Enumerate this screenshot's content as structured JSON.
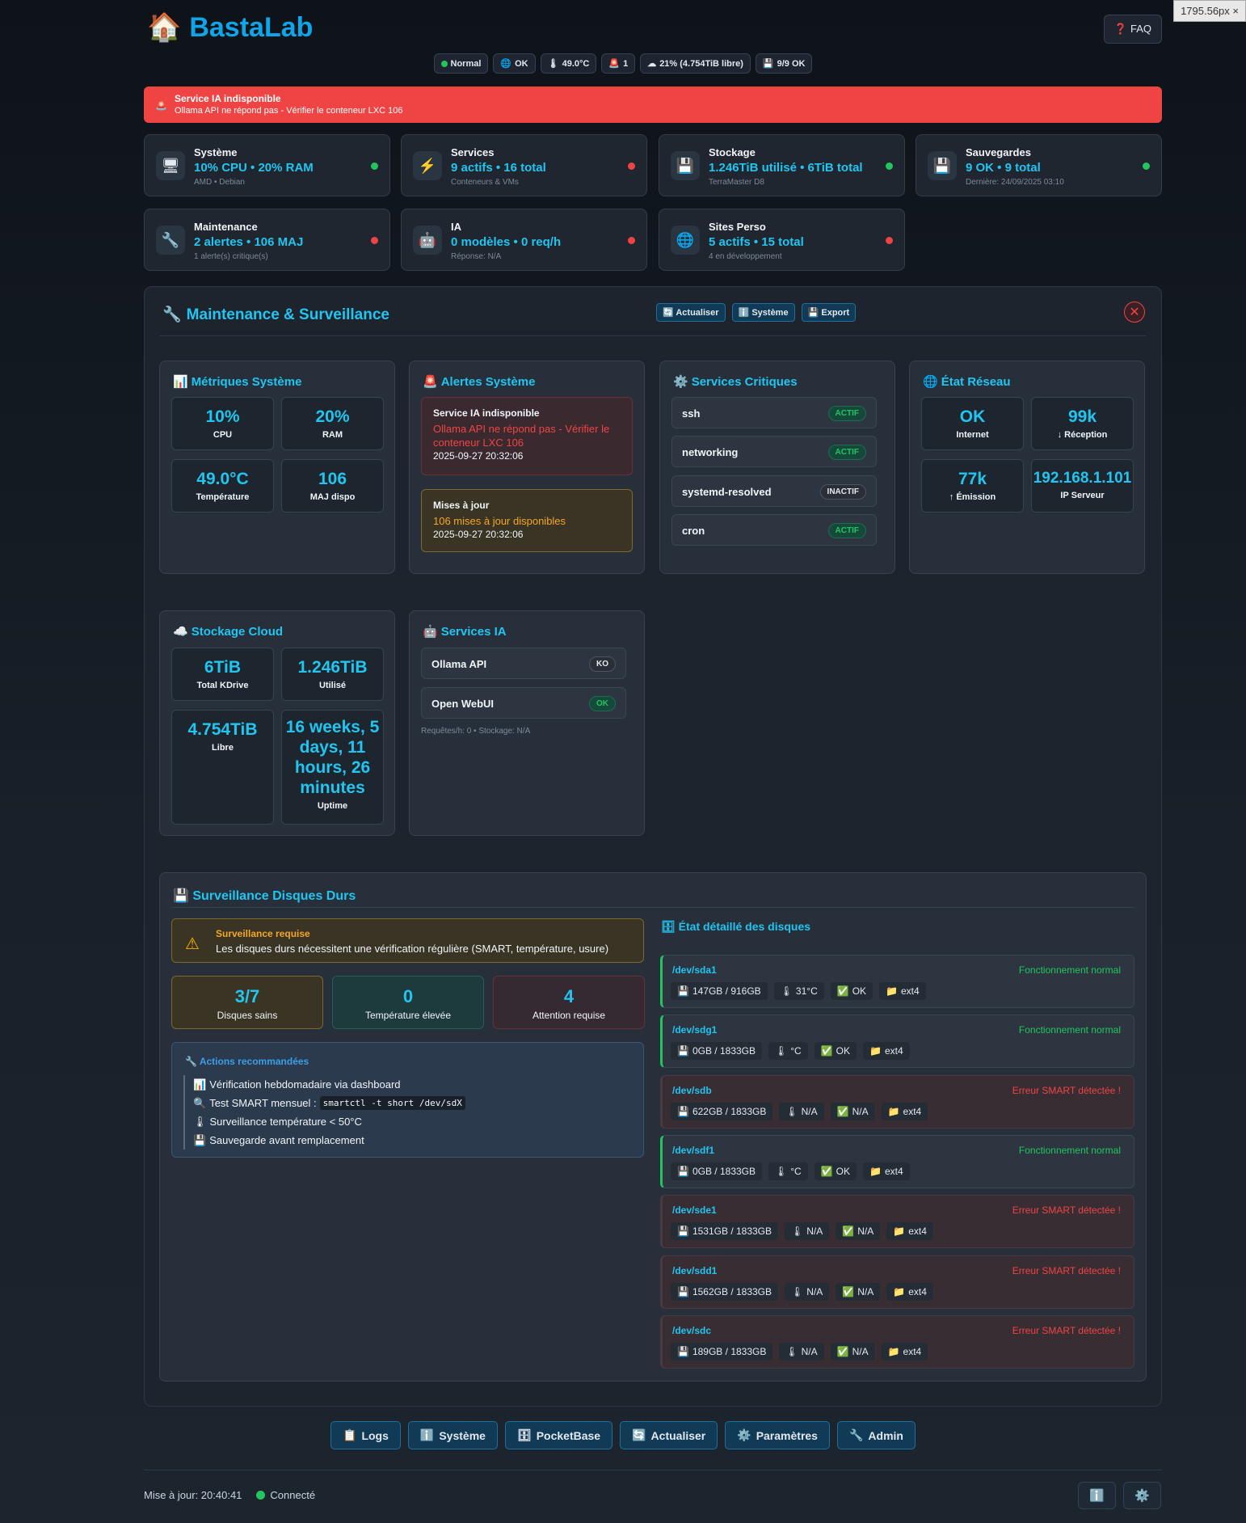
{
  "viewport": "1795.56px ×",
  "brand": {
    "name": "BastaLab",
    "icon": "house-icon"
  },
  "faq": "FAQ",
  "status_pills": [
    {
      "text": "Normal",
      "icon": "green-dot"
    },
    {
      "text": "OK",
      "icon": "globe-icon"
    },
    {
      "text": "49.0°C",
      "icon": "thermometer-icon"
    },
    {
      "text": "1",
      "icon": "siren-icon"
    },
    {
      "text": "21% (4.754TiB libre)",
      "icon": "cloud-icon"
    },
    {
      "text": "9/9 OK",
      "icon": "floppy-icon"
    }
  ],
  "alert": {
    "title": "Service IA indisponible",
    "message": "Ollama API ne répond pas - Vérifier le conteneur LXC 106"
  },
  "cards": [
    {
      "title": "Système",
      "value": "10% CPU • 20% RAM",
      "sub": "AMD • Debian",
      "icon": "computer-icon",
      "status": "#22c55e"
    },
    {
      "title": "Services",
      "value": "9 actifs • 16 total",
      "sub": "Conteneurs & VMs",
      "icon": "lightning-icon",
      "status": "#ef4444"
    },
    {
      "title": "Stockage",
      "value": "1.246TiB utilisé • 6TiB total",
      "sub": "TerraMaster D8",
      "icon": "floppy-icon",
      "status": "#22c55e"
    },
    {
      "title": "Sauvegardes",
      "value": "9 OK • 9 total",
      "sub": "Dernière: 24/09/2025 03:10",
      "icon": "floppy-icon",
      "status": "#22c55e"
    },
    {
      "title": "Maintenance",
      "value": "2 alertes • 106 MAJ",
      "sub": "1 alerte(s) critique(s)",
      "icon": "wrench-icon",
      "status": "#ef4444"
    },
    {
      "title": "IA",
      "value": "0 modèles • 0 req/h",
      "sub": "Réponse: N/A",
      "icon": "robot-icon",
      "status": "#ef4444"
    },
    {
      "title": "Sites Perso",
      "value": "5 actifs • 15 total",
      "sub": "4 en développement",
      "icon": "globe-icon",
      "status": "#ef4444"
    }
  ],
  "panel": {
    "title": "Maintenance & Surveillance",
    "buttons": [
      "Actualiser",
      "Système",
      "Export"
    ],
    "metrics": {
      "title": "Métriques Système",
      "items": [
        {
          "value": "10%",
          "label": "CPU"
        },
        {
          "value": "20%",
          "label": "RAM"
        },
        {
          "value": "49.0°C",
          "label": "Température"
        },
        {
          "value": "106",
          "label": "MAJ dispo"
        }
      ]
    },
    "alerts": {
      "title": "Alertes Système",
      "items": [
        {
          "title": "Service IA indisponible",
          "message": "Ollama API ne répond pas - Vérifier le conteneur LXC 106",
          "date": "2025-09-27 20:32:06"
        },
        {
          "title": "Mises à jour",
          "message": "106 mises à jour disponibles",
          "date": "2025-09-27 20:32:06"
        }
      ]
    },
    "services": {
      "title": "Services Critiques",
      "items": [
        {
          "name": "ssh",
          "status": "ACTIF"
        },
        {
          "name": "networking",
          "status": "ACTIF"
        },
        {
          "name": "systemd-resolved",
          "status": "INACTIF"
        },
        {
          "name": "cron",
          "status": "ACTIF"
        }
      ]
    },
    "network": {
      "title": "État Réseau",
      "items": [
        {
          "value": "OK",
          "label": "Internet"
        },
        {
          "value": "99k",
          "label": "↓ Réception"
        },
        {
          "value": "77k",
          "label": "↑ Émission"
        },
        {
          "value": "192.168.1.101",
          "label": "IP Serveur"
        }
      ]
    },
    "cloud": {
      "title": "Stockage Cloud",
      "items": [
        {
          "value": "6TiB",
          "label": "Total KDrive"
        },
        {
          "value": "1.246TiB",
          "label": "Utilisé"
        },
        {
          "value": "4.754TiB",
          "label": "Libre"
        },
        {
          "value": "16 weeks, 5 days, 11 hours, 26 minutes",
          "label": "Uptime"
        }
      ]
    },
    "ai": {
      "title": "Services IA",
      "items": [
        {
          "name": "Ollama API",
          "status": "KO"
        },
        {
          "name": "Open WebUI",
          "status": "OK"
        }
      ],
      "note": "Requêtes/h: 0 • Stockage: N/A"
    },
    "disks": {
      "title": "Surveillance Disques Durs",
      "warn_title": "Surveillance requise",
      "warn_msg": "Les disques durs nécessitent une vérification régulière (SMART, température, usure)",
      "stats": [
        {
          "value": "3/7",
          "label": "Disques sains"
        },
        {
          "value": "0",
          "label": "Température élevée"
        },
        {
          "value": "4",
          "label": "Attention requise"
        }
      ],
      "reco_title": "Actions recommandées",
      "reco": [
        {
          "icon": "chart-icon",
          "text": "Vérification hebdomadaire via dashboard",
          "code": ""
        },
        {
          "icon": "magnifier-icon",
          "text": "Test SMART mensuel :",
          "code": "smartctl -t short /dev/sdX"
        },
        {
          "icon": "thermometer-icon",
          "text": "Surveillance température < 50°C",
          "code": ""
        },
        {
          "icon": "floppy-icon",
          "text": "Sauvegarde avant remplacement",
          "code": ""
        }
      ],
      "detail_title": "État détaillé des disques",
      "list": [
        {
          "name": "/dev/sda1",
          "status": "Fonctionnement normal",
          "ok": true,
          "usage": "147GB / 916GB",
          "temp": "31°C",
          "smart": "OK",
          "fs": "ext4"
        },
        {
          "name": "/dev/sdg1",
          "status": "Fonctionnement normal",
          "ok": true,
          "usage": "0GB / 1833GB",
          "temp": "°C",
          "smart": "OK",
          "fs": "ext4"
        },
        {
          "name": "/dev/sdb",
          "status": "Erreur SMART détectée !",
          "ok": false,
          "usage": "622GB / 1833GB",
          "temp": "N/A",
          "smart": "N/A",
          "fs": "ext4"
        },
        {
          "name": "/dev/sdf1",
          "status": "Fonctionnement normal",
          "ok": true,
          "usage": "0GB / 1833GB",
          "temp": "°C",
          "smart": "OK",
          "fs": "ext4"
        },
        {
          "name": "/dev/sde1",
          "status": "Erreur SMART détectée !",
          "ok": false,
          "usage": "1531GB / 1833GB",
          "temp": "N/A",
          "smart": "N/A",
          "fs": "ext4"
        },
        {
          "name": "/dev/sdd1",
          "status": "Erreur SMART détectée !",
          "ok": false,
          "usage": "1562GB / 1833GB",
          "temp": "N/A",
          "smart": "N/A",
          "fs": "ext4"
        },
        {
          "name": "/dev/sdc",
          "status": "Erreur SMART détectée !",
          "ok": false,
          "usage": "189GB / 1833GB",
          "temp": "N/A",
          "smart": "N/A",
          "fs": "ext4"
        }
      ]
    }
  },
  "footer_buttons": [
    {
      "label": "Logs",
      "icon": "clipboard-icon"
    },
    {
      "label": "Système",
      "icon": "info-icon"
    },
    {
      "label": "PocketBase",
      "icon": "database-icon"
    },
    {
      "label": "Actualiser",
      "icon": "refresh-icon"
    },
    {
      "label": "Paramètres",
      "icon": "gear-icon"
    },
    {
      "label": "Admin",
      "icon": "wrench-icon"
    }
  ],
  "footer": {
    "updated": "Mise à jour: 20:40:41",
    "connection": "Connecté"
  }
}
